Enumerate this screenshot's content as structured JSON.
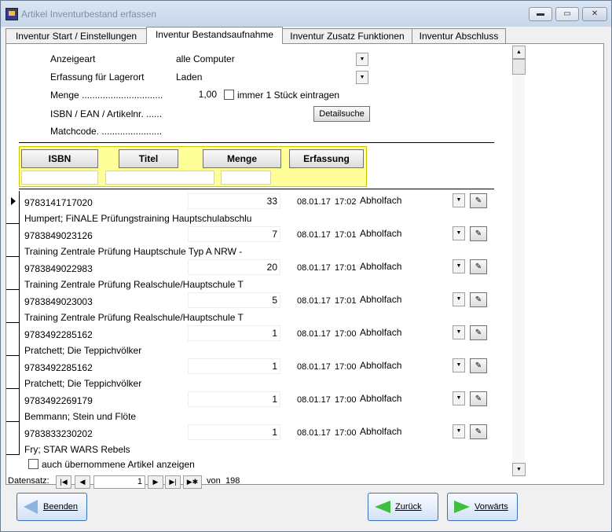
{
  "window": {
    "title": "Artikel Inventurbestand erfassen",
    "controls": [
      "▬",
      "▭",
      "✕"
    ]
  },
  "tabs": [
    {
      "label": "Inventur Start / Einstellungen"
    },
    {
      "label": "Inventur Bestandsaufnahme"
    },
    {
      "label": "Inventur Zusatz Funktionen"
    },
    {
      "label": "Inventur Abschluss"
    }
  ],
  "form": {
    "anzeigeart_label": "Anzeigeart",
    "anzeigeart_value": "alle Computer",
    "lagerort_label": "Erfassung für Lagerort",
    "lagerort_value": "Laden",
    "menge_label": "Menge ...............................",
    "menge_value": "1,00",
    "immer_label": "immer 1 Stück eintragen",
    "isbn_label": "ISBN / EAN / Artikelnr. ......",
    "detailsuche": "Detailsuche",
    "matchcode_label": "Matchcode. ......................."
  },
  "columns": [
    "ISBN",
    "Titel",
    "Menge",
    "Erfassung"
  ],
  "rows": [
    {
      "isbn": "9783141717020",
      "menge": "33",
      "date": "08.01.17",
      "time": "17:02",
      "fach": "Abholfach",
      "titel": "Humpert; FiNALE Prüfungstraining Hauptschulabschlu"
    },
    {
      "isbn": "9783849023126",
      "menge": "7",
      "date": "08.01.17",
      "time": "17:01",
      "fach": "Abholfach",
      "titel": "Training Zentrale Prüfung Hauptschule Typ A NRW -"
    },
    {
      "isbn": "9783849022983",
      "menge": "20",
      "date": "08.01.17",
      "time": "17:01",
      "fach": "Abholfach",
      "titel": "Training Zentrale Prüfung Realschule/Hauptschule T"
    },
    {
      "isbn": "9783849023003",
      "menge": "5",
      "date": "08.01.17",
      "time": "17:01",
      "fach": "Abholfach",
      "titel": "Training Zentrale Prüfung Realschule/Hauptschule T"
    },
    {
      "isbn": "9783492285162",
      "menge": "1",
      "date": "08.01.17",
      "time": "17:00",
      "fach": "Abholfach",
      "titel": "Pratchett; Die Teppichvölker"
    },
    {
      "isbn": "9783492285162",
      "menge": "1",
      "date": "08.01.17",
      "time": "17:00",
      "fach": "Abholfach",
      "titel": "Pratchett; Die Teppichvölker"
    },
    {
      "isbn": "9783492269179",
      "menge": "1",
      "date": "08.01.17",
      "time": "17:00",
      "fach": "Abholfach",
      "titel": "Bemmann; Stein und Flöte"
    },
    {
      "isbn": "9783833230202",
      "menge": "1",
      "date": "08.01.17",
      "time": "17:00",
      "fach": "Abholfach",
      "titel": "Fry; STAR WARS Rebels"
    }
  ],
  "auch_label": "auch übernommene Artikel anzeigen",
  "navigator": {
    "label": "Datensatz:",
    "current": "1",
    "of": "von",
    "total": "198"
  },
  "buttons": {
    "beenden": "Beenden",
    "zurueck": "Zurück",
    "vorwaerts": "Vorwärts"
  }
}
